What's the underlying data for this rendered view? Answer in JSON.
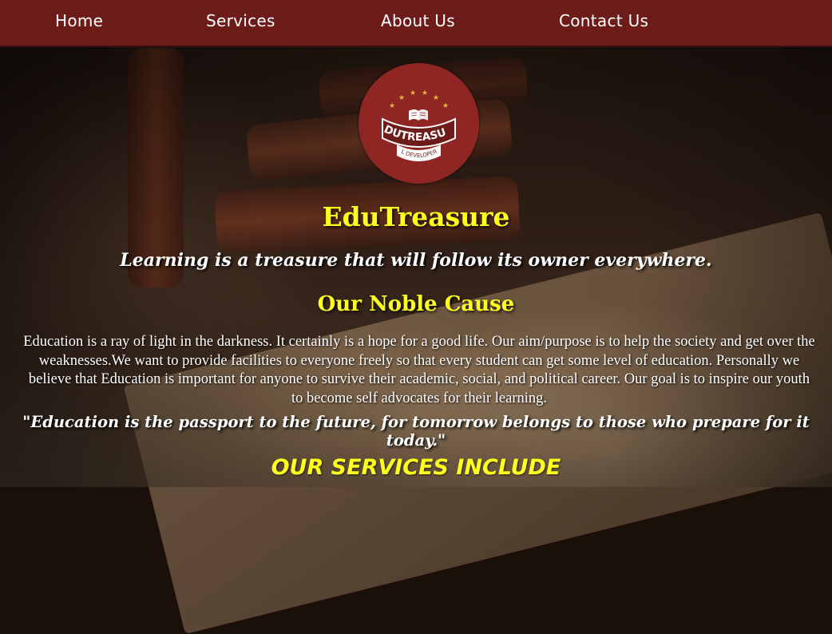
{
  "nav": {
    "items": [
      {
        "label": "Home"
      },
      {
        "label": "Services"
      },
      {
        "label": "About Us"
      },
      {
        "label": "Contact Us"
      }
    ]
  },
  "logo": {
    "icon": "open-book-icon",
    "name": "EDUTREASURE",
    "sub": "OL DEVELOPERS",
    "circle_color": "#8f2624"
  },
  "hero": {
    "title": "EduTreasure",
    "tagline": "Learning is a treasure that will follow its owner everywhere."
  },
  "cause": {
    "heading": "Our Noble Cause",
    "text": "Education is a ray of light in the darkness. It certainly is a hope for a good life. Our aim/purpose is to help the society and get over the weaknesses.We want to provide facilities to everyone freely so that every student can get some level of education. Personally we believe that Education is important for anyone to survive their academic, social, and political career. Our goal is to inspire our youth to become self advocates for their learning."
  },
  "quote": "\"Education is the passport to the future, for tomorrow belongs to those who prepare for it today.\"",
  "services": {
    "heading": "OUR SERVICES INCLUDE"
  },
  "colors": {
    "nav_bg": "#6e1c1a",
    "accent_yellow": "#ffff1e",
    "text_white": "#ffffff"
  }
}
